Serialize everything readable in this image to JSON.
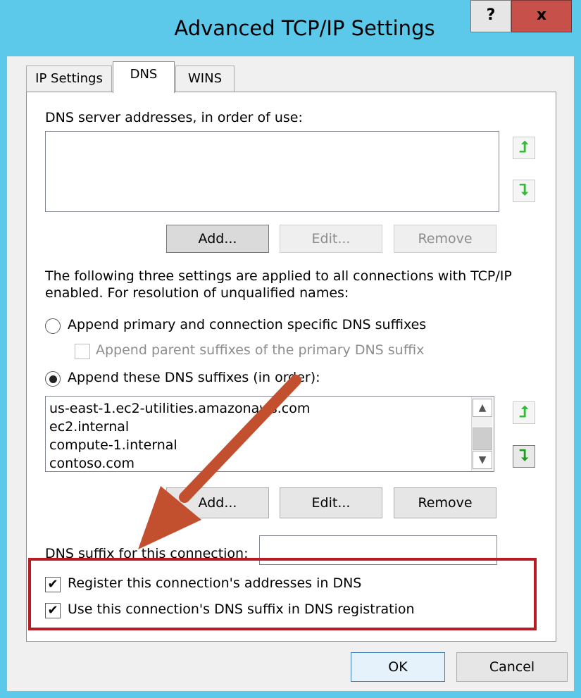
{
  "window": {
    "title": "Advanced TCP/IP Settings",
    "help_label": "?",
    "close_label": "x"
  },
  "tabs": [
    {
      "label": "IP Settings",
      "selected": false
    },
    {
      "label": "DNS",
      "selected": true
    },
    {
      "label": "WINS",
      "selected": false
    }
  ],
  "dns_servers": {
    "label": "DNS server addresses, in order of use:",
    "items": [],
    "buttons": {
      "add": "Add...",
      "edit": "Edit...",
      "remove": "Remove"
    }
  },
  "info_text": {
    "line1": "The following three settings are applied to all connections with TCP/IP",
    "line2": "enabled. For resolution of unqualified names:"
  },
  "options": {
    "append_primary": {
      "label": "Append primary and connection specific DNS suffixes",
      "selected": false
    },
    "append_parent": {
      "label": "Append parent suffixes of the primary DNS suffix",
      "checked": false,
      "enabled": false
    },
    "append_these": {
      "label": "Append these DNS suffixes (in order):",
      "selected": true
    }
  },
  "suffix_list": {
    "items": [
      "us-east-1.ec2-utilities.amazonaws.com",
      "ec2.internal",
      "compute-1.internal",
      "contoso.com"
    ],
    "buttons": {
      "add": "Add...",
      "edit": "Edit...",
      "remove": "Remove"
    }
  },
  "connection_suffix": {
    "label": "DNS suffix for this connection:",
    "value": ""
  },
  "registration": {
    "register": {
      "label": "Register this connection's addresses in DNS",
      "checked": true
    },
    "use_suffix": {
      "label": "Use this connection's DNS suffix in DNS registration",
      "checked": true
    }
  },
  "footer": {
    "ok": "OK",
    "cancel": "Cancel"
  },
  "icons": {
    "move_up": "up-arrow-icon",
    "move_down": "down-arrow-icon",
    "check_mark": "✔"
  },
  "colors": {
    "title_bar": "#5cc8ea",
    "close_button": "#c7504a",
    "highlight_box": "#b81b22",
    "annotation_arrow": "#c2502f",
    "arrow_icon_green": "#38b838"
  }
}
